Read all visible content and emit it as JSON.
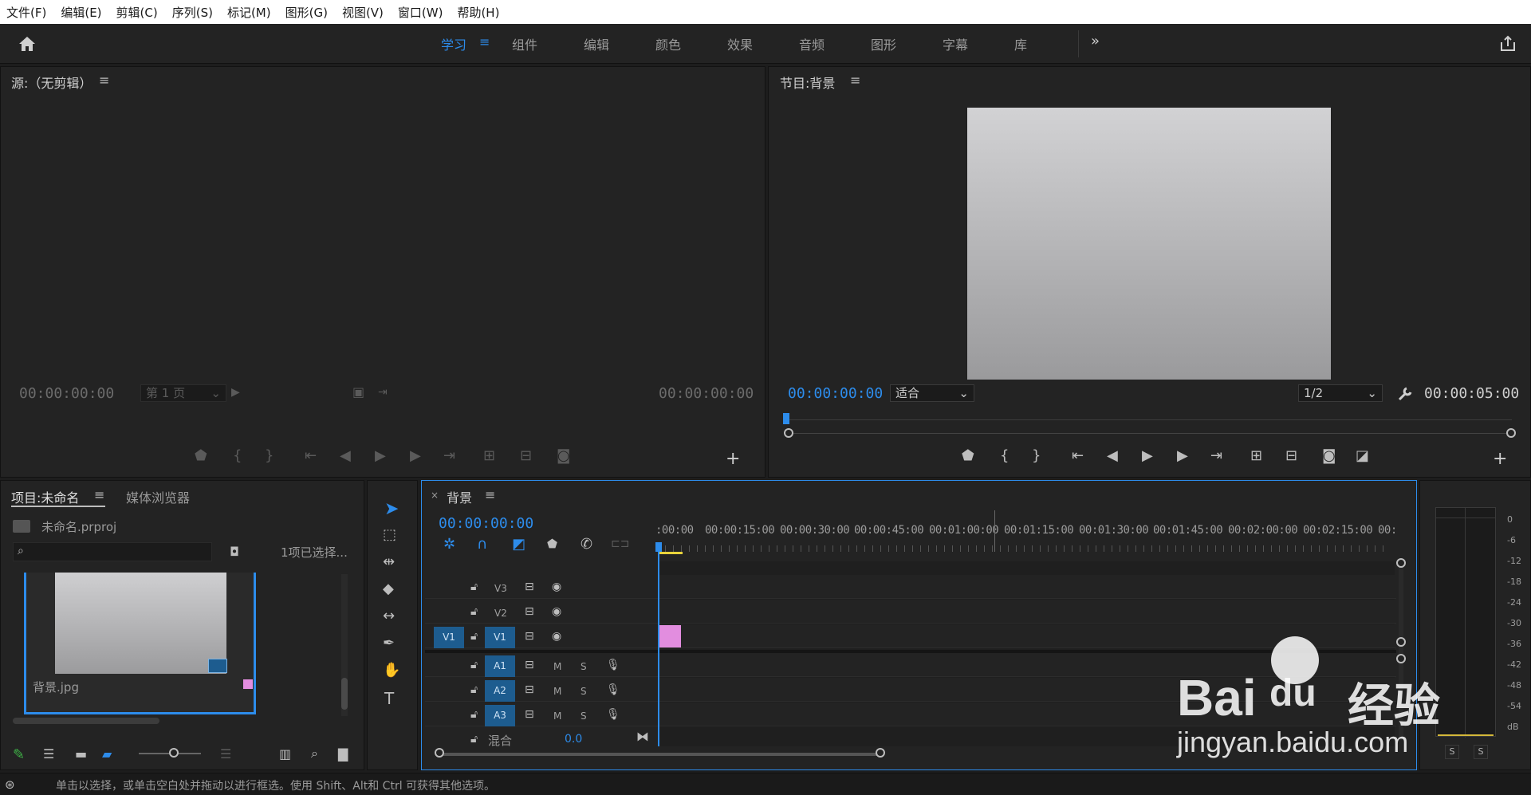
{
  "menu": [
    "文件(F)",
    "编辑(E)",
    "剪辑(C)",
    "序列(S)",
    "标记(M)",
    "图形(G)",
    "视图(V)",
    "窗口(W)",
    "帮助(H)"
  ],
  "workspaces": [
    "学习",
    "组件",
    "编辑",
    "颜色",
    "效果",
    "音频",
    "图形",
    "字幕",
    "库"
  ],
  "source": {
    "title": "源:（无剪辑）",
    "tc_left": "00:00:00:00",
    "page_select": "第 1 页",
    "tc_right": "00:00:00:00"
  },
  "program": {
    "title": "节目:背景",
    "tc_left": "00:00:00:00",
    "fit": "适合",
    "resolution": "1/2",
    "tc_right": "00:00:05:00"
  },
  "project": {
    "tab_project": "项目:未命名",
    "tab_media": "媒体浏览器",
    "file": "未命名.prproj",
    "selection": "1项已选择...",
    "clip_name": "背景.jpg"
  },
  "timeline": {
    "tab": "背景",
    "timecode": "00:00:00:00",
    "ruler": [
      ":00:00",
      "00:00:15:00",
      "00:00:30:00",
      "00:00:45:00",
      "00:01:00:00",
      "00:01:15:00",
      "00:01:30:00",
      "00:01:45:00",
      "00:02:00:00",
      "00:02:15:00",
      "00:"
    ],
    "video_tracks": [
      "V3",
      "V2",
      "V1"
    ],
    "audio_tracks": [
      "A1",
      "A2",
      "A3"
    ],
    "source_patch": "V1",
    "mix_label": "混合",
    "mix_value": "0.0",
    "btn_m": "M",
    "btn_s": "S"
  },
  "meter": {
    "labels": [
      "0",
      "-6",
      "-12",
      "-18",
      "-24",
      "-30",
      "-36",
      "-42",
      "-48",
      "-54",
      "dB"
    ],
    "solo_left": "S",
    "solo_right": "S"
  },
  "status": "单击以选择，或单击空白处并拖动以进行框选。使用 Shift、Alt和 Ctrl 可获得其他选项。",
  "watermark": {
    "brand": "Bai",
    "brand2": "du",
    "cn": "经验",
    "url": "jingyan.baidu.com"
  },
  "colors": {
    "accent": "#2d8ceb",
    "clip": "#e28ddf",
    "track_btn": "#1d5c8f"
  }
}
